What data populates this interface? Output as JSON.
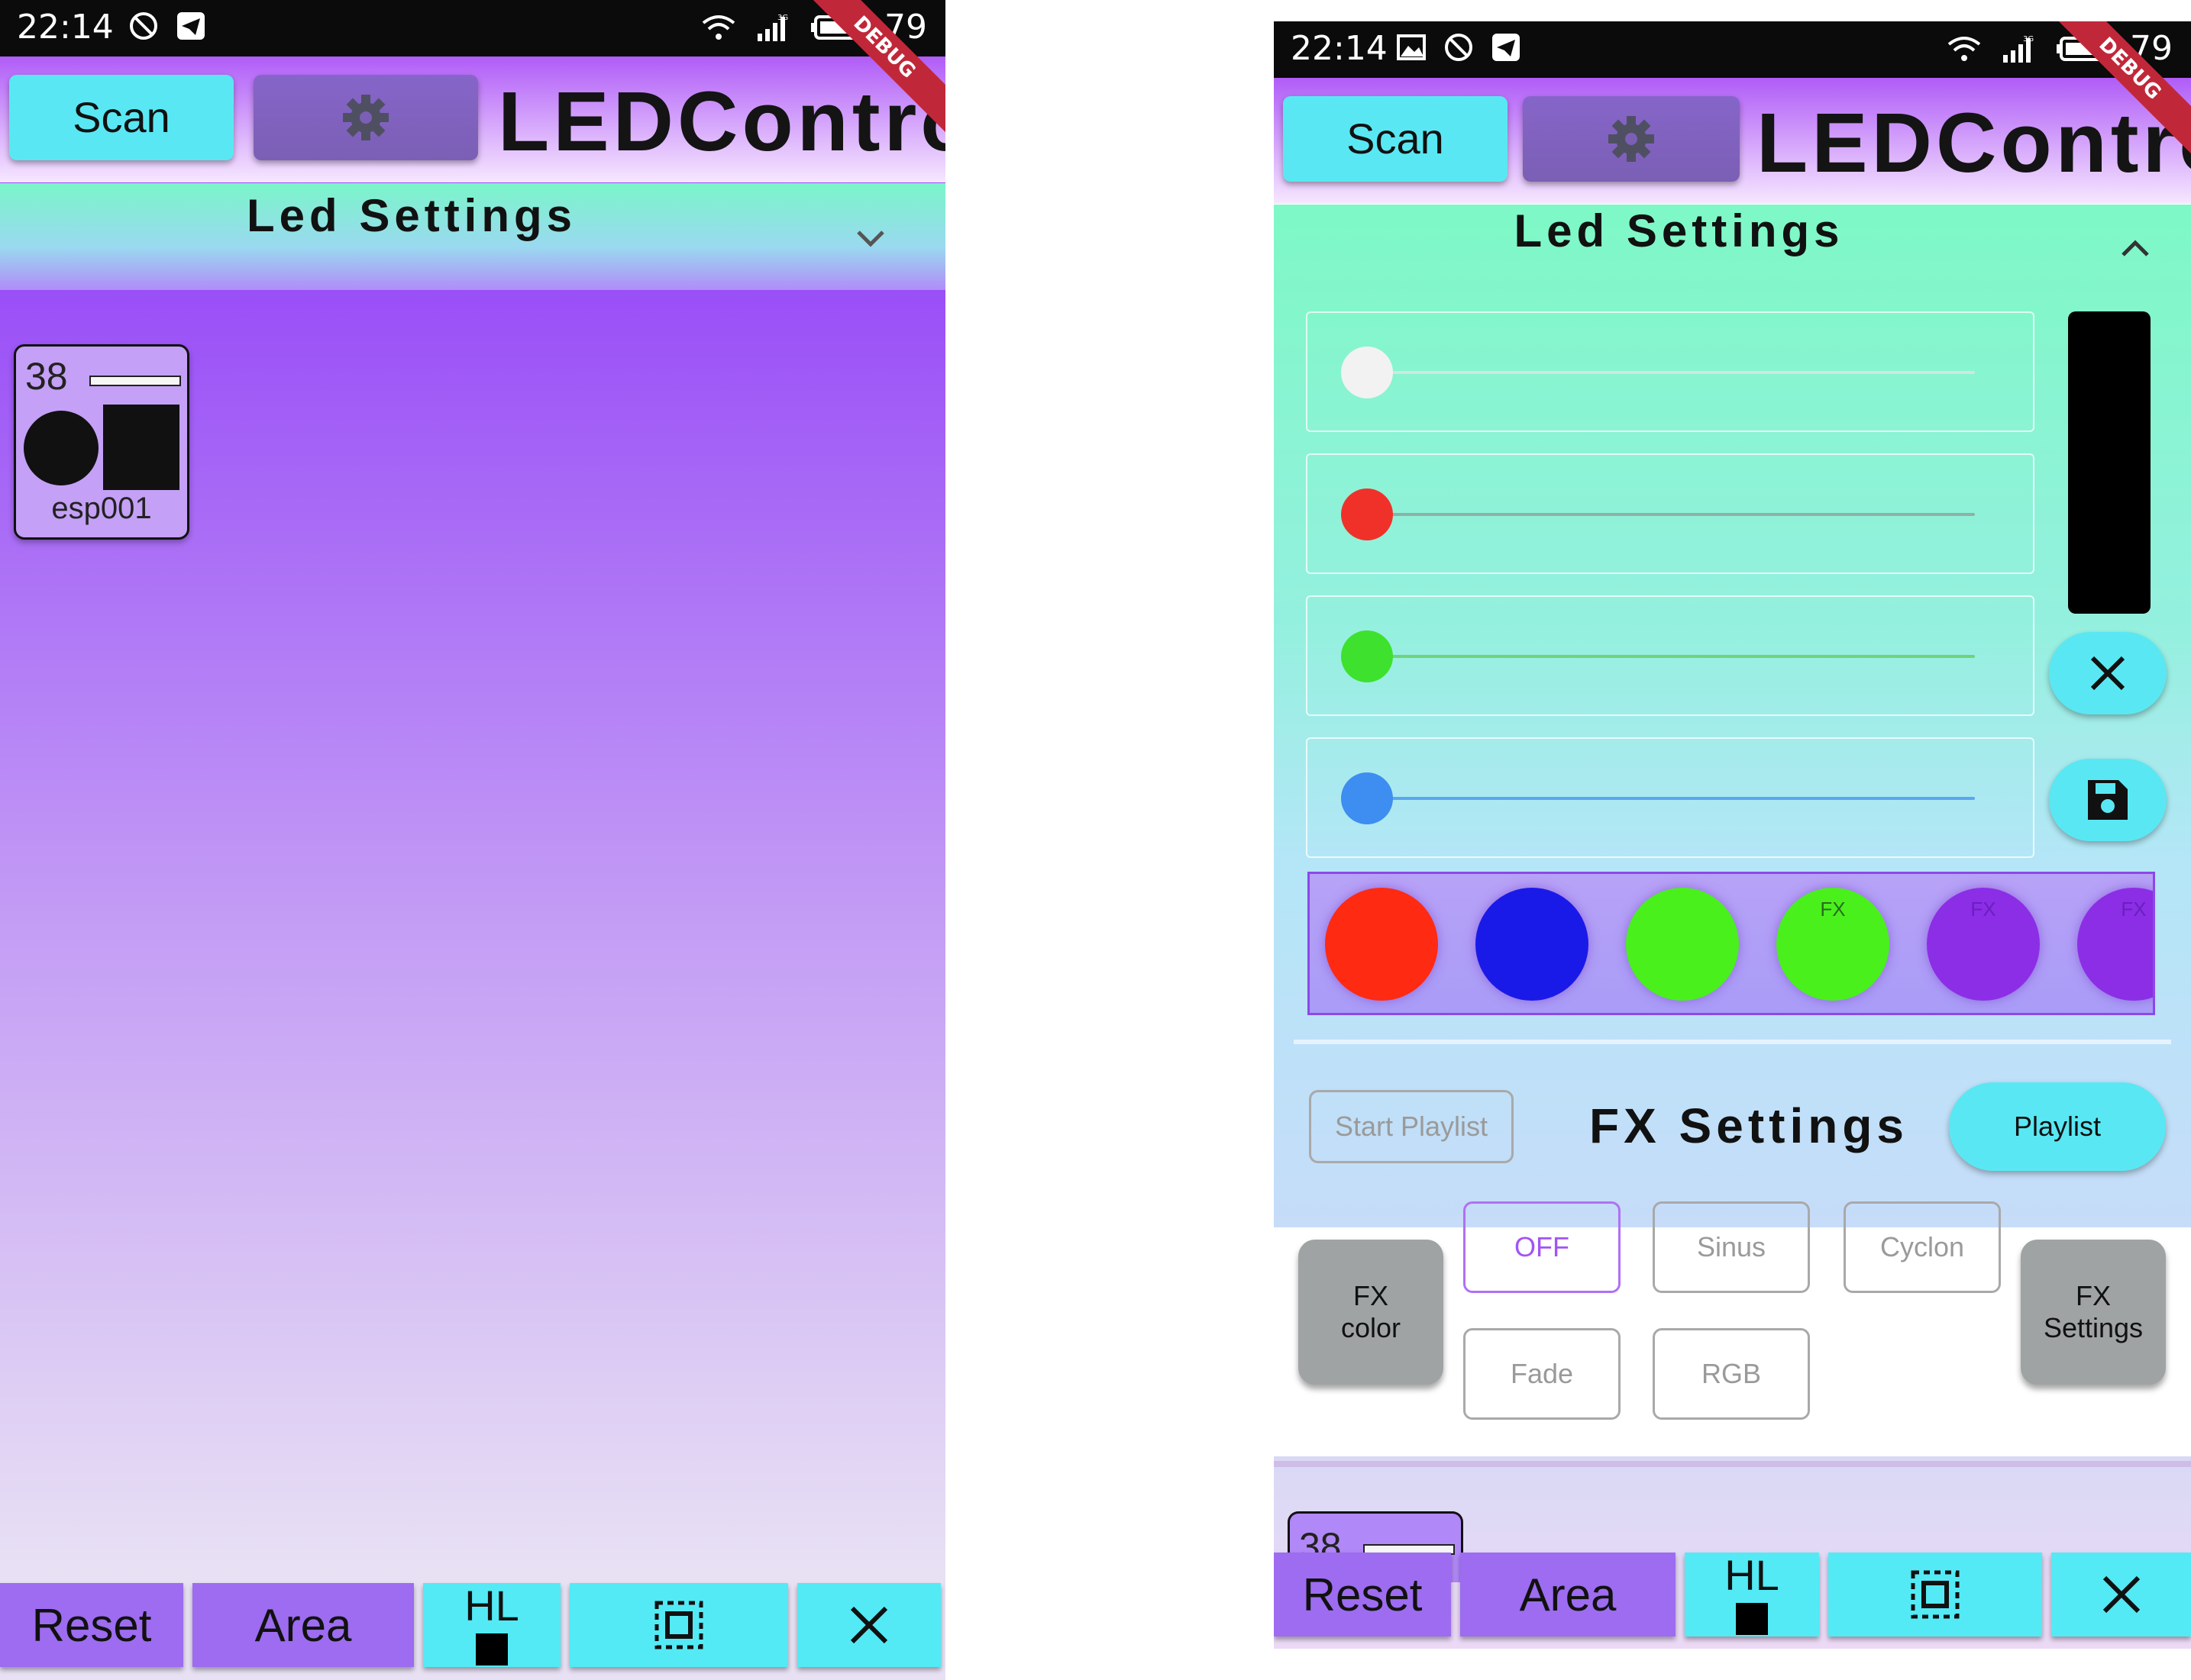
{
  "status_bar": {
    "time": "22:14",
    "battery": "79",
    "network": "3G",
    "debug_ribbon": "DEBUG"
  },
  "app_bar": {
    "scan_label": "Scan",
    "title": "LEDControl"
  },
  "led_settings": {
    "title": "Led Settings"
  },
  "device": {
    "number": "38",
    "name": "esp001"
  },
  "sliders": [
    {
      "channel": "white",
      "thumb_color": "#f2f2f2",
      "track_color": "#cfe8df",
      "value": 0
    },
    {
      "channel": "red",
      "thumb_color": "#f0312a",
      "track_color": "#8fb0a4",
      "value": 0
    },
    {
      "channel": "green",
      "thumb_color": "#3ee12e",
      "track_color": "#6fd37a",
      "value": 0
    },
    {
      "channel": "blue",
      "thumb_color": "#3d8ef0",
      "track_color": "#5aa6f0",
      "value": 0
    }
  ],
  "color_preview": "#000000",
  "swatches": [
    {
      "color": "#ff2a12",
      "label": ""
    },
    {
      "color": "#1a1ae8",
      "label": ""
    },
    {
      "color": "#49f01c",
      "label": ""
    },
    {
      "color": "#49f01c",
      "label": "FX"
    },
    {
      "color": "#8c2ee6",
      "label": "FX"
    },
    {
      "color": "#8c2ee6",
      "label": "FX"
    }
  ],
  "fx": {
    "start_playlist": "Start Playlist",
    "title": "FX Settings",
    "playlist": "Playlist",
    "fx_color": "FX color",
    "fx_settings": "FX Settings",
    "modes": [
      "OFF",
      "Sinus",
      "Cyclon",
      "Fade",
      "RGB"
    ],
    "selected_mode": "OFF"
  },
  "bottom_bar": {
    "reset": "Reset",
    "area": "Area",
    "hl": "HL"
  },
  "colors": {
    "accent_cyan": "#59e8f3",
    "accent_purple": "#9d6cf0",
    "panel_green": "#7ef8c6",
    "background_purple": "#9a4ff7"
  }
}
